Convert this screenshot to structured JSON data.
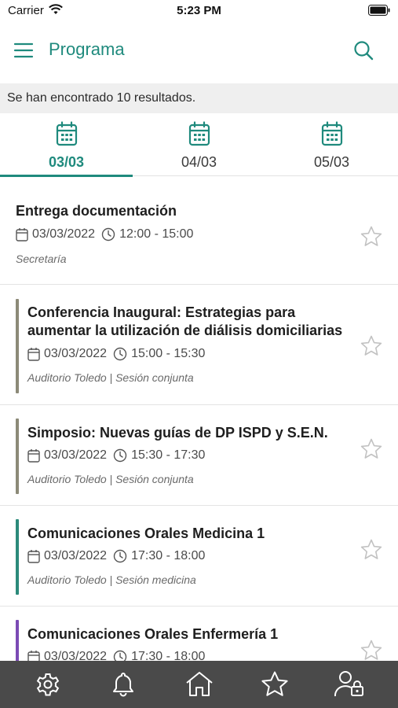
{
  "status": {
    "carrier": "Carrier",
    "time": "5:23 PM"
  },
  "header": {
    "title": "Programa"
  },
  "results": {
    "text": "Se han encontrado 10 resultados."
  },
  "tabs": [
    {
      "label": "03/03",
      "active": true
    },
    {
      "label": "04/03",
      "active": false
    },
    {
      "label": "05/03",
      "active": false
    }
  ],
  "events": [
    {
      "title": "Entrega documentación",
      "date": "03/03/2022",
      "time": "12:00 - 15:00",
      "location": "Secretaría",
      "bar_color": ""
    },
    {
      "title": "Conferencia Inaugural: Estrategias para aumentar la utilización de diálisis domiciliarias",
      "date": "03/03/2022",
      "time": "15:00 - 15:30",
      "location": "Auditorio Toledo | Sesión conjunta",
      "bar_color": "#8c8a78"
    },
    {
      "title": "Simposio: Nuevas guías de DP ISPD y S.E.N.",
      "date": "03/03/2022",
      "time": "15:30 - 17:30",
      "location": "Auditorio Toledo | Sesión conjunta",
      "bar_color": "#8c8a78"
    },
    {
      "title": "Comunicaciones Orales Medicina 1",
      "date": "03/03/2022",
      "time": "17:30 - 18:00",
      "location": "Auditorio Toledo | Sesión medicina",
      "bar_color": "#2b8a7a"
    },
    {
      "title": "Comunicaciones Orales Enfermería 1",
      "date": "03/03/2022",
      "time": "17:30 - 18:00",
      "location": "",
      "bar_color": "#7b4bb5"
    }
  ],
  "bottom_nav": [
    {
      "icon": "gear-icon"
    },
    {
      "icon": "bell-icon"
    },
    {
      "icon": "home-icon"
    },
    {
      "icon": "star-icon"
    },
    {
      "icon": "user-lock-icon"
    }
  ],
  "colors": {
    "accent": "#1f8a7d",
    "nav_bg": "#4a4a4a",
    "results_bg": "#efefef"
  }
}
